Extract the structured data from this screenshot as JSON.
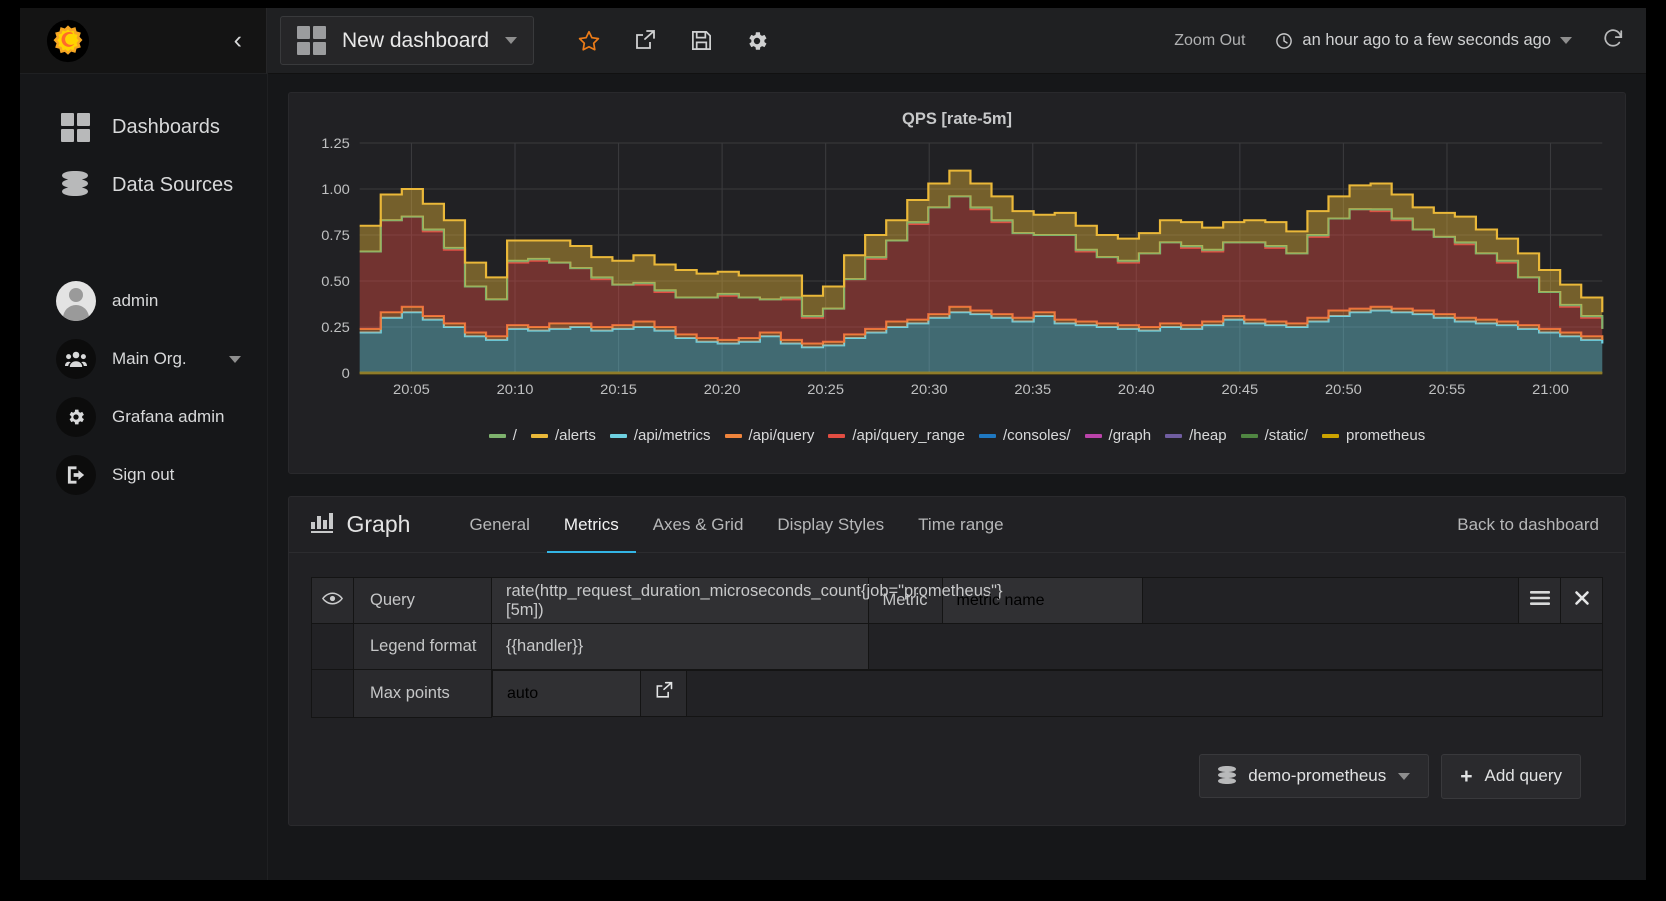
{
  "brand": {
    "logo_name": "grafana-logo",
    "accent": "#33b5e5"
  },
  "sidebar": {
    "collapse_label": "‹",
    "nav": [
      {
        "label": "Dashboards",
        "icon": "grid-icon"
      },
      {
        "label": "Data Sources",
        "icon": "database-icon"
      }
    ],
    "user": [
      {
        "label": "admin",
        "icon": "avatar"
      },
      {
        "label": "Main Org.",
        "icon": "users-icon",
        "caret": true
      },
      {
        "label": "Grafana admin",
        "icon": "gear-icon"
      },
      {
        "label": "Sign out",
        "icon": "sign-out-icon"
      }
    ]
  },
  "topbar": {
    "dashboard_title": "New dashboard",
    "icons": [
      "star-icon",
      "share-icon",
      "save-icon",
      "settings-icon"
    ],
    "zoom_out": "Zoom Out",
    "time_range": "an hour ago to a few seconds ago",
    "refresh": "refresh-icon"
  },
  "panel": {
    "title": "QPS [rate-5m]"
  },
  "chart_data": {
    "type": "area",
    "stacked": true,
    "title": "QPS [rate-5m]",
    "xlabel": "",
    "ylabel": "",
    "ylim": [
      0,
      1.25
    ],
    "yticks": [
      "0",
      "0.25",
      "0.50",
      "0.75",
      "1.00",
      "1.25"
    ],
    "ytick_values": [
      0,
      0.25,
      0.5,
      0.75,
      1.0,
      1.25
    ],
    "xticks": [
      "20:05",
      "20:10",
      "20:15",
      "20:20",
      "20:25",
      "20:30",
      "20:35",
      "20:40",
      "20:45",
      "20:50",
      "20:55",
      "21:00"
    ],
    "grid": true,
    "legend_position": "bottom",
    "series": [
      {
        "name": "/",
        "color": "#7eb26d",
        "visible_band": true,
        "values": [
          0.0,
          0.0,
          0.0,
          0.01,
          0.01,
          0.0,
          0.0,
          0.01,
          0.01,
          0.0,
          0.0,
          0.01,
          0.0,
          0.01,
          0.01,
          0.0,
          0.0,
          0.01,
          0.0,
          0.0,
          0.01,
          0.01,
          0.0,
          0.0,
          0.01,
          0.0,
          0.01,
          0.0,
          0.0,
          0.01,
          0.01,
          0.0,
          0.0,
          0.0,
          0.01,
          0.0,
          0.01,
          0.0,
          0.0,
          0.01,
          0.01,
          0.0,
          0.0,
          0.01,
          0.0,
          0.01,
          0.0,
          0.0,
          0.01,
          0.01,
          0.0,
          0.0,
          0.01,
          0.0,
          0.01,
          0.0,
          0.0,
          0.01,
          0.01,
          0.0
        ]
      },
      {
        "name": "/alerts",
        "color": "#eab839",
        "values": [
          0.14,
          0.14,
          0.15,
          0.14,
          0.15,
          0.13,
          0.12,
          0.11,
          0.1,
          0.12,
          0.12,
          0.11,
          0.13,
          0.15,
          0.14,
          0.15,
          0.13,
          0.12,
          0.12,
          0.13,
          0.12,
          0.11,
          0.12,
          0.13,
          0.12,
          0.11,
          0.12,
          0.13,
          0.14,
          0.13,
          0.13,
          0.12,
          0.11,
          0.12,
          0.13,
          0.12,
          0.12,
          0.11,
          0.12,
          0.13,
          0.12,
          0.11,
          0.12,
          0.13,
          0.12,
          0.13,
          0.12,
          0.13,
          0.14,
          0.13,
          0.12,
          0.13,
          0.14,
          0.13,
          0.12,
          0.13,
          0.12,
          0.11,
          0.1,
          0.09
        ]
      },
      {
        "name": "/api/metrics",
        "color": "#6ed0e0",
        "values": [
          0.22,
          0.3,
          0.33,
          0.29,
          0.25,
          0.2,
          0.18,
          0.24,
          0.23,
          0.24,
          0.25,
          0.23,
          0.24,
          0.25,
          0.23,
          0.19,
          0.17,
          0.16,
          0.17,
          0.2,
          0.16,
          0.14,
          0.15,
          0.19,
          0.22,
          0.25,
          0.27,
          0.3,
          0.33,
          0.32,
          0.3,
          0.28,
          0.31,
          0.27,
          0.26,
          0.25,
          0.24,
          0.23,
          0.25,
          0.24,
          0.26,
          0.29,
          0.27,
          0.26,
          0.25,
          0.28,
          0.31,
          0.33,
          0.34,
          0.33,
          0.32,
          0.3,
          0.28,
          0.27,
          0.26,
          0.24,
          0.22,
          0.2,
          0.18,
          0.16
        ]
      },
      {
        "name": "/api/query",
        "color": "#ef843c",
        "values": [
          0.02,
          0.03,
          0.03,
          0.02,
          0.02,
          0.02,
          0.02,
          0.02,
          0.02,
          0.03,
          0.02,
          0.02,
          0.02,
          0.03,
          0.02,
          0.02,
          0.02,
          0.02,
          0.02,
          0.02,
          0.02,
          0.02,
          0.02,
          0.02,
          0.02,
          0.03,
          0.02,
          0.02,
          0.03,
          0.02,
          0.02,
          0.02,
          0.02,
          0.02,
          0.02,
          0.02,
          0.02,
          0.02,
          0.02,
          0.02,
          0.02,
          0.02,
          0.02,
          0.02,
          0.02,
          0.02,
          0.03,
          0.02,
          0.02,
          0.02,
          0.02,
          0.02,
          0.02,
          0.02,
          0.02,
          0.02,
          0.02,
          0.02,
          0.02,
          0.02
        ]
      },
      {
        "name": "/api/query_range",
        "color": "#e24d42",
        "values": [
          0.42,
          0.5,
          0.49,
          0.46,
          0.4,
          0.25,
          0.2,
          0.34,
          0.36,
          0.33,
          0.3,
          0.26,
          0.22,
          0.2,
          0.19,
          0.2,
          0.22,
          0.24,
          0.22,
          0.18,
          0.22,
          0.14,
          0.18,
          0.3,
          0.38,
          0.44,
          0.52,
          0.58,
          0.6,
          0.55,
          0.5,
          0.46,
          0.42,
          0.46,
          0.38,
          0.36,
          0.34,
          0.4,
          0.44,
          0.42,
          0.38,
          0.4,
          0.42,
          0.4,
          0.38,
          0.44,
          0.5,
          0.54,
          0.52,
          0.48,
          0.44,
          0.42,
          0.4,
          0.36,
          0.32,
          0.26,
          0.2,
          0.14,
          0.1,
          0.06
        ]
      },
      {
        "name": "/consoles/",
        "color": "#1f78c1",
        "values": [
          0.0,
          0.0,
          0.0,
          0.0,
          0.0,
          0.0,
          0.0,
          0.0,
          0.0,
          0.0,
          0.0,
          0.0,
          0.0,
          0.0,
          0.0,
          0.0,
          0.0,
          0.0,
          0.0,
          0.0,
          0.0,
          0.0,
          0.0,
          0.0,
          0.0,
          0.0,
          0.0,
          0.0,
          0.0,
          0.0,
          0.0,
          0.0,
          0.0,
          0.0,
          0.0,
          0.0,
          0.0,
          0.0,
          0.0,
          0.0,
          0.0,
          0.0,
          0.0,
          0.0,
          0.0,
          0.0,
          0.0,
          0.0,
          0.0,
          0.0,
          0.0,
          0.0,
          0.0,
          0.0,
          0.0,
          0.0,
          0.0,
          0.0,
          0.0,
          0.0
        ]
      },
      {
        "name": "/graph",
        "color": "#ba43a9",
        "values": [
          0.0,
          0.0,
          0.0,
          0.0,
          0.0,
          0.0,
          0.0,
          0.0,
          0.0,
          0.0,
          0.0,
          0.0,
          0.0,
          0.0,
          0.0,
          0.0,
          0.0,
          0.0,
          0.0,
          0.0,
          0.0,
          0.0,
          0.0,
          0.0,
          0.0,
          0.0,
          0.0,
          0.0,
          0.0,
          0.0,
          0.0,
          0.0,
          0.0,
          0.0,
          0.0,
          0.0,
          0.0,
          0.0,
          0.0,
          0.0,
          0.0,
          0.0,
          0.0,
          0.0,
          0.0,
          0.0,
          0.0,
          0.0,
          0.0,
          0.0,
          0.0,
          0.0,
          0.0,
          0.0,
          0.0,
          0.0,
          0.0,
          0.0,
          0.0,
          0.0
        ]
      },
      {
        "name": "/heap",
        "color": "#705da0",
        "values": [
          0.0,
          0.0,
          0.0,
          0.0,
          0.0,
          0.0,
          0.0,
          0.0,
          0.0,
          0.0,
          0.0,
          0.0,
          0.0,
          0.0,
          0.0,
          0.0,
          0.0,
          0.0,
          0.0,
          0.0,
          0.0,
          0.0,
          0.0,
          0.0,
          0.0,
          0.0,
          0.0,
          0.0,
          0.0,
          0.0,
          0.0,
          0.0,
          0.0,
          0.0,
          0.0,
          0.0,
          0.0,
          0.0,
          0.0,
          0.0,
          0.0,
          0.0,
          0.0,
          0.0,
          0.0,
          0.0,
          0.0,
          0.0,
          0.0,
          0.0,
          0.0,
          0.0,
          0.0,
          0.0,
          0.0,
          0.0,
          0.0,
          0.0,
          0.0,
          0.0
        ]
      },
      {
        "name": "/static/",
        "color": "#508642",
        "values": [
          0.0,
          0.0,
          0.0,
          0.0,
          0.0,
          0.0,
          0.0,
          0.0,
          0.0,
          0.0,
          0.0,
          0.0,
          0.0,
          0.0,
          0.0,
          0.0,
          0.0,
          0.0,
          0.0,
          0.0,
          0.0,
          0.0,
          0.0,
          0.0,
          0.0,
          0.0,
          0.0,
          0.0,
          0.0,
          0.0,
          0.0,
          0.0,
          0.0,
          0.0,
          0.0,
          0.0,
          0.0,
          0.0,
          0.0,
          0.0,
          0.0,
          0.0,
          0.0,
          0.0,
          0.0,
          0.0,
          0.0,
          0.0,
          0.0,
          0.0,
          0.0,
          0.0,
          0.0,
          0.0,
          0.0,
          0.0,
          0.0,
          0.0,
          0.0,
          0.0
        ]
      },
      {
        "name": "prometheus",
        "color": "#cca300",
        "values": [
          0.0,
          0.0,
          0.0,
          0.0,
          0.0,
          0.0,
          0.0,
          0.0,
          0.0,
          0.0,
          0.0,
          0.0,
          0.0,
          0.0,
          0.0,
          0.0,
          0.0,
          0.0,
          0.0,
          0.0,
          0.0,
          0.0,
          0.0,
          0.0,
          0.0,
          0.0,
          0.0,
          0.0,
          0.0,
          0.0,
          0.0,
          0.0,
          0.0,
          0.0,
          0.0,
          0.0,
          0.0,
          0.0,
          0.0,
          0.0,
          0.0,
          0.0,
          0.0,
          0.0,
          0.0,
          0.0,
          0.0,
          0.0,
          0.0,
          0.0,
          0.0,
          0.0,
          0.0,
          0.0,
          0.0,
          0.0,
          0.0,
          0.0,
          0.0,
          0.0
        ]
      }
    ]
  },
  "editor": {
    "panel_type": "Graph",
    "tabs": [
      {
        "label": "General",
        "active": false
      },
      {
        "label": "Metrics",
        "active": true
      },
      {
        "label": "Axes & Grid",
        "active": false
      },
      {
        "label": "Display Styles",
        "active": false
      },
      {
        "label": "Time range",
        "active": false
      }
    ],
    "back_link": "Back to dashboard",
    "rows": {
      "query_label": "Query",
      "query_value": "rate(http_request_duration_microseconds_count{job=\"prometheus\"}[5m])",
      "metric_label": "Metric",
      "metric_placeholder": "metric name",
      "legend_label": "Legend format",
      "legend_value": "{{handler}}",
      "maxpoints_label": "Max points",
      "maxpoints_placeholder": "auto"
    },
    "datasource": "demo-prometheus",
    "add_query": "Add query"
  }
}
